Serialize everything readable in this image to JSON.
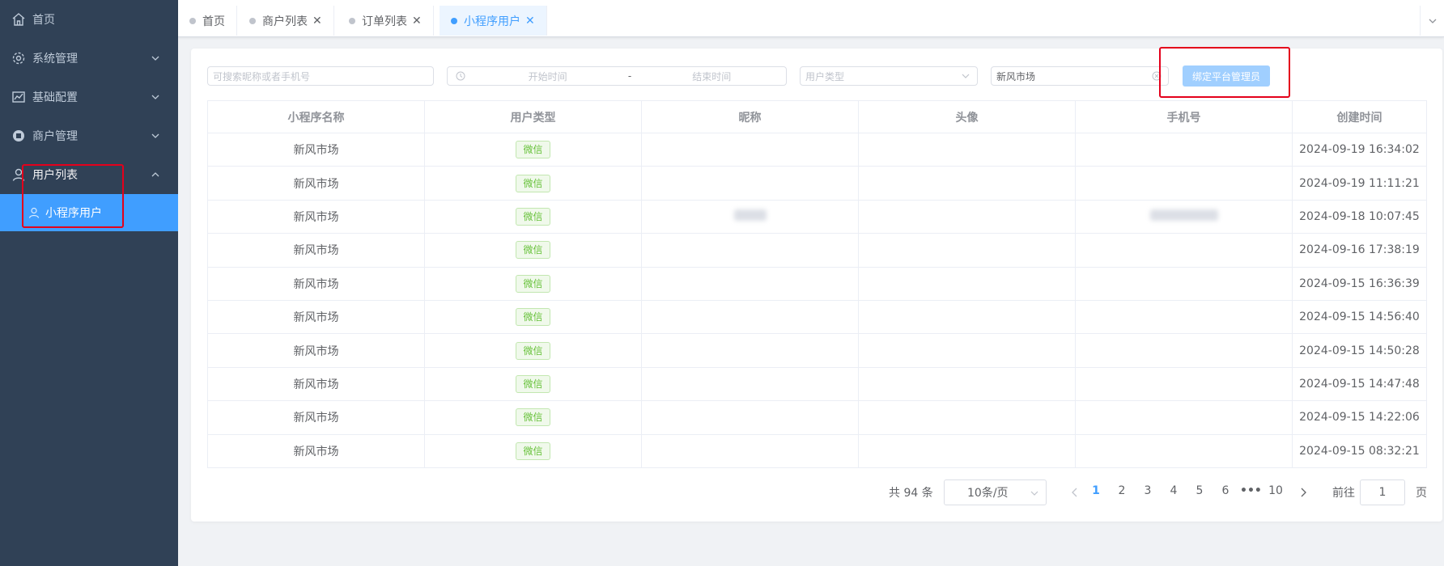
{
  "sidebar": {
    "items": [
      {
        "label": "首页",
        "icon": "home-icon"
      },
      {
        "label": "系统管理",
        "icon": "gear-icon"
      },
      {
        "label": "基础配置",
        "icon": "chart-icon"
      },
      {
        "label": "商户管理",
        "icon": "store-icon"
      },
      {
        "label": "用户列表",
        "icon": "user-icon"
      }
    ],
    "sub_item": {
      "label": "小程序用户",
      "icon": "user-outline-icon"
    }
  },
  "tags": [
    {
      "label": "首页"
    },
    {
      "label": "商户列表"
    },
    {
      "label": "订单列表"
    },
    {
      "label": "小程序用户"
    }
  ],
  "filters": {
    "search_placeholder": "可搜索昵称或者手机号",
    "date_start_placeholder": "开始时间",
    "date_separator": "-",
    "date_end_placeholder": "结束时间",
    "user_type_placeholder": "用户类型",
    "mini_program_value": "新风市场",
    "bind_button": "绑定平台管理员"
  },
  "table": {
    "columns": [
      "小程序名称",
      "用户类型",
      "昵称",
      "头像",
      "手机号",
      "创建时间"
    ],
    "rows": [
      {
        "name": "新风市场",
        "type": "微信",
        "created": "2024-09-19 16:34:02"
      },
      {
        "name": "新风市场",
        "type": "微信",
        "created": "2024-09-19 11:11:21"
      },
      {
        "name": "新风市场",
        "type": "微信",
        "created": "2024-09-18 10:07:45"
      },
      {
        "name": "新风市场",
        "type": "微信",
        "created": "2024-09-16 17:38:19"
      },
      {
        "name": "新风市场",
        "type": "微信",
        "created": "2024-09-15 16:36:39"
      },
      {
        "name": "新风市场",
        "type": "微信",
        "created": "2024-09-15 14:56:40"
      },
      {
        "name": "新风市场",
        "type": "微信",
        "created": "2024-09-15 14:50:28"
      },
      {
        "name": "新风市场",
        "type": "微信",
        "created": "2024-09-15 14:47:48"
      },
      {
        "name": "新风市场",
        "type": "微信",
        "created": "2024-09-15 14:22:06"
      },
      {
        "name": "新风市场",
        "type": "微信",
        "created": "2024-09-15 08:32:21"
      }
    ]
  },
  "pagination": {
    "total": "共 94 条",
    "page_size": "10条/页",
    "pages": [
      "1",
      "2",
      "3",
      "4",
      "5",
      "6",
      "•••",
      "10"
    ],
    "current": "1",
    "jump_label": "前往",
    "jump_value": "1",
    "jump_unit": "页"
  },
  "colors": {
    "sidebar_bg": "#304156",
    "active_blue": "#409eff",
    "highlight_red": "#e4001b",
    "badge_green": "#67c23a"
  }
}
